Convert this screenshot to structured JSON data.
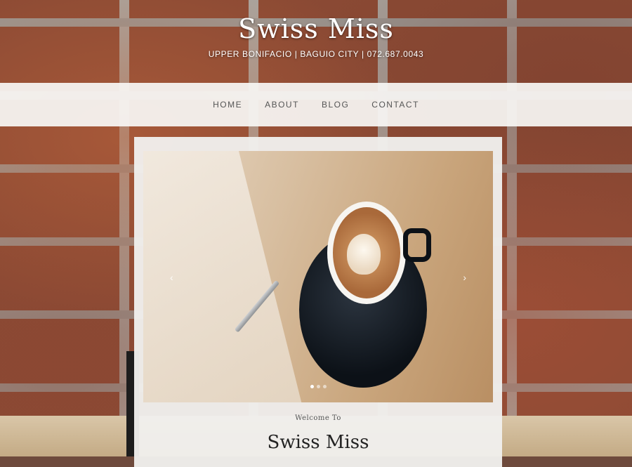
{
  "header": {
    "title": "Swiss Miss",
    "address": "UPPER BONIFACIO | BAGUIO CITY | 072.687.0043"
  },
  "nav": {
    "items": [
      "HOME",
      "ABOUT",
      "BLOG",
      "CONTACT"
    ]
  },
  "slider": {
    "prev_glyph": "‹",
    "next_glyph": "›",
    "slide_count": 3,
    "active_slide": 1
  },
  "intro": {
    "welcome": "Welcome To",
    "title": "Swiss Miss"
  }
}
